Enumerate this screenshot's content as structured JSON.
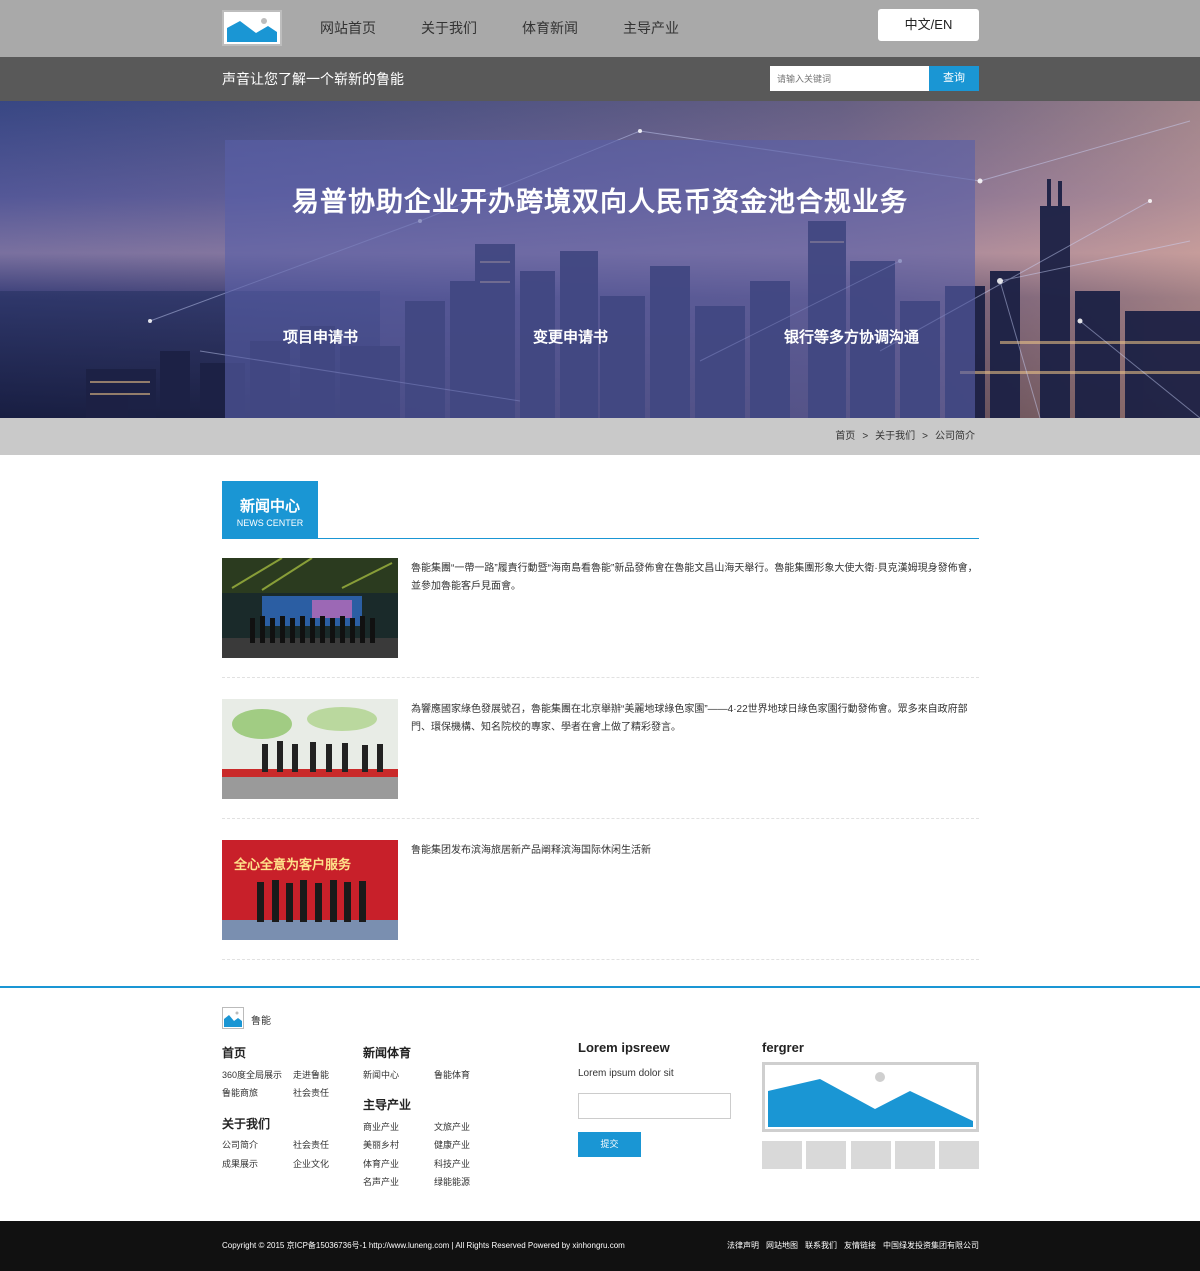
{
  "nav": {
    "items": [
      "网站首页",
      "关于我们",
      "体育新闻",
      "主导产业"
    ],
    "lang_label": "中文/EN"
  },
  "subbar": {
    "slogan": "声音让您了解一个崭新的鲁能",
    "search_placeholder": "请输入关键词",
    "search_button": "查询"
  },
  "banner": {
    "title": "易普协助企业开办跨境双向人民币资金池合规业务",
    "items": [
      "项目申请书",
      "变更申请书",
      "银行等多方协调沟通"
    ]
  },
  "breadcrumb": {
    "items": [
      "首页",
      "关于我们",
      "公司简介"
    ],
    "separator": ">"
  },
  "news_section": {
    "title_cn": "新闻中心",
    "title_en": "NEWS CENTER",
    "items": [
      {
        "text": "魯能集團“一帶一路”履責行動暨“海南島看魯能”新品發佈會在魯能文昌山海天舉行。魯能集團形象大使大衛·貝克漢姆現身發佈會，並參加魯能客戶見面會。"
      },
      {
        "text": "為響應國家綠色發展號召，魯能集團在北京舉辦“美麗地球綠色家園”——4·22世界地球日綠色家園行動發佈會。眾多來自政府部門、環保機構、知名院校的專家、學者在會上做了精彩發言。"
      },
      {
        "text": "鲁能集团发布滨海旅居新产品阐释滨海国际休闲生活新",
        "banner_caption": "全心全意为客户服务"
      }
    ]
  },
  "footer": {
    "brand": "鲁能",
    "col1": {
      "head1": "首页",
      "links1": [
        "360度全局展示",
        "走进鲁能",
        "鲁能商旅",
        "社会责任"
      ],
      "head2": "关于我们",
      "links2": [
        "公司简介",
        "社会责任",
        "成果展示",
        "企业文化"
      ]
    },
    "col2": {
      "head1": "新闻体育",
      "links1": [
        "新闻中心",
        "鲁能体育"
      ],
      "head2": "主导产业",
      "links2": [
        "商业产业",
        "文旅产业",
        "美丽乡村",
        "健康产业",
        "体育产业",
        "科技产业",
        "名声产业",
        "绿能能源"
      ]
    },
    "subscribe": {
      "title": "Lorem ipsreew",
      "subtitle": "Lorem ipsum dolor sit",
      "button": "提交"
    },
    "gallery_title": "fergrer"
  },
  "bottom": {
    "copyright": "Copyright © 2015 京ICP备15036736号-1 http://www.luneng.com | All Rights Reserved Powered by xinhongru.com",
    "links": [
      "法律声明",
      "网站地图",
      "联系我们",
      "友情链接",
      "中国绿发投资集团有限公司"
    ]
  },
  "colors": {
    "accent": "#1a96d4",
    "topbar": "#a9a9a9",
    "subbar": "#595959",
    "bottombar": "#111111"
  },
  "icons": [
    "image-placeholder-icon"
  ]
}
